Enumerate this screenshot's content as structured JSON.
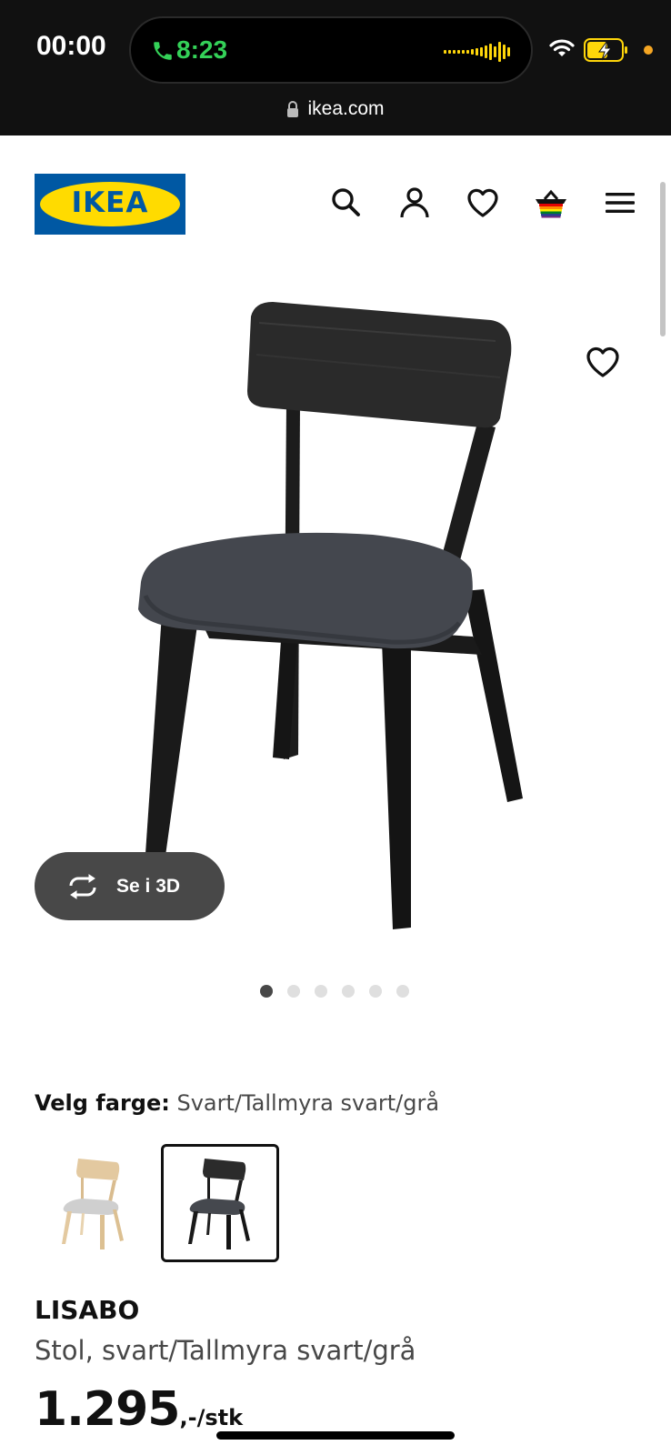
{
  "status_bar": {
    "time": "00:00",
    "call_time": "8:23",
    "url": "ikea.com",
    "colors": {
      "call_green": "#34d158",
      "record_dot": "#f5a623",
      "battery_yellow": "#ffd60a"
    }
  },
  "header": {
    "logo_text": "IKEA",
    "icons": [
      "search-icon",
      "account-icon",
      "heart-icon",
      "basket-icon",
      "menu-icon"
    ],
    "brand_colors": {
      "blue": "#0058a3",
      "yellow": "#ffdb00"
    }
  },
  "gallery": {
    "view_3d_label": "Se i 3D",
    "page_count": 6,
    "active_page": 1
  },
  "color_picker": {
    "label": "Velg farge:",
    "selected_value": "Svart/Tallmyra svart/grå",
    "options": [
      "light-wood-chair-swatch",
      "black-chair-swatch"
    ],
    "selected_index": 1
  },
  "product": {
    "name": "LISABO",
    "description": "Stol, svart/Tallmyra svart/grå",
    "price": "1.295",
    "price_unit": ",-/stk"
  }
}
